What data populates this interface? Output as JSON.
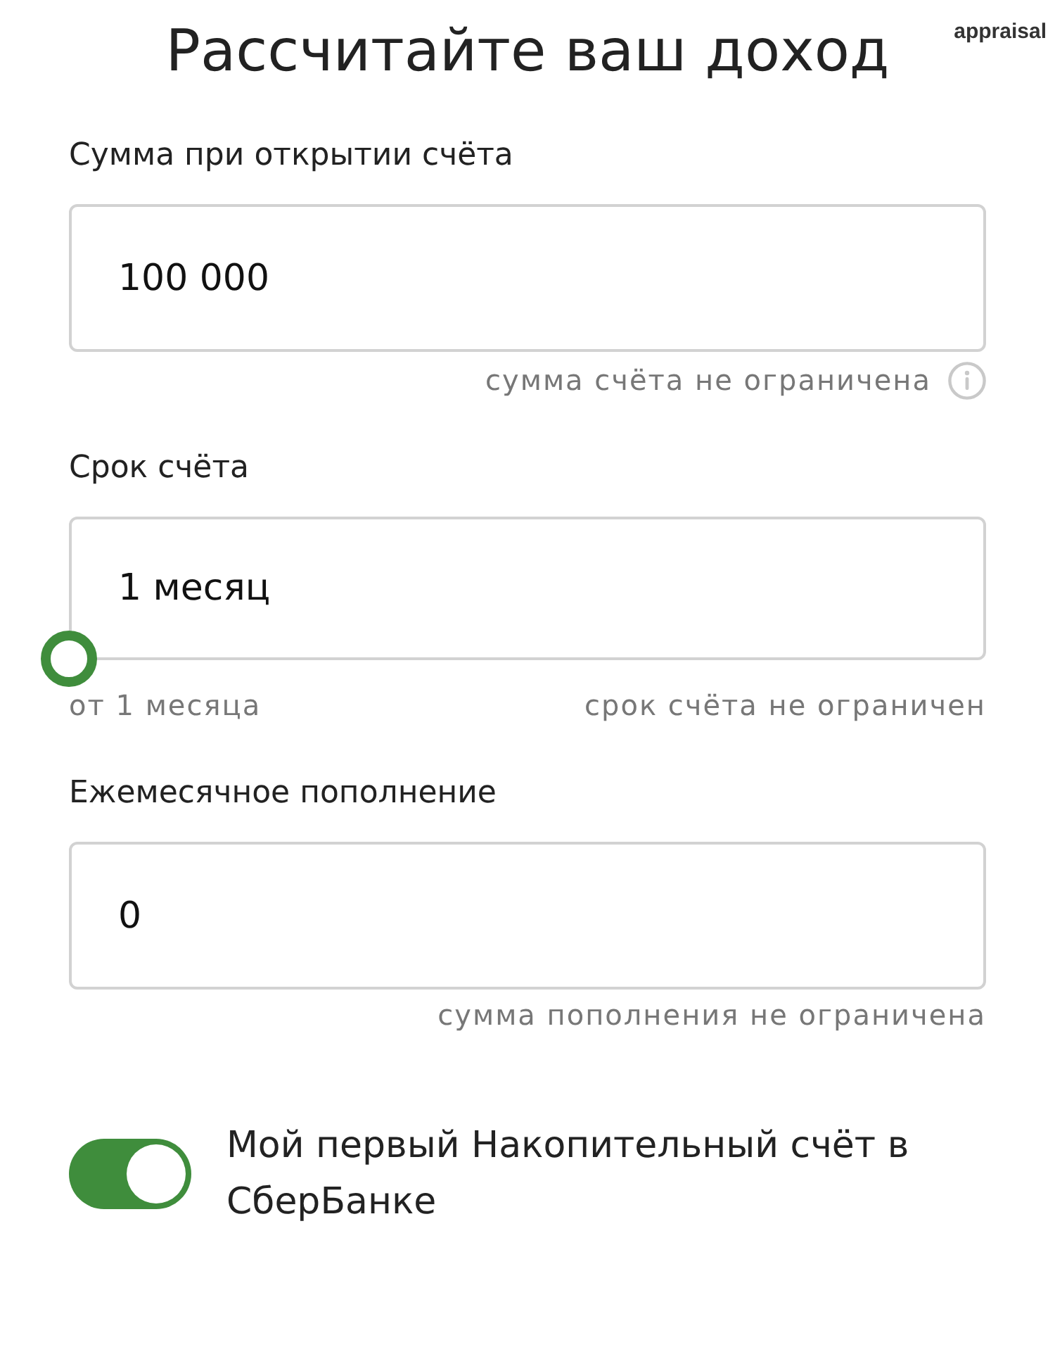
{
  "overlay_label": "appraisal",
  "title": "Рассчитайте ваш доход",
  "fields": [
    {
      "kind": "plain",
      "label": "Сумма при открытии счёта",
      "value": "100 000",
      "hint": "сумма счёта не ограничена",
      "info": true
    },
    {
      "kind": "slider",
      "label": "Срок счёта",
      "value": "1 месяц",
      "level": 0,
      "min_label": "от 1 месяца",
      "max_label": "срок счёта не ограничен"
    },
    {
      "kind": "plain",
      "label": "Ежемесячное пополнение",
      "value": "0",
      "hint": "сумма пополнения не ограничена"
    }
  ],
  "toggle": {
    "label": "Мой первый Накопительный счёт в СберБанке",
    "on": true
  }
}
